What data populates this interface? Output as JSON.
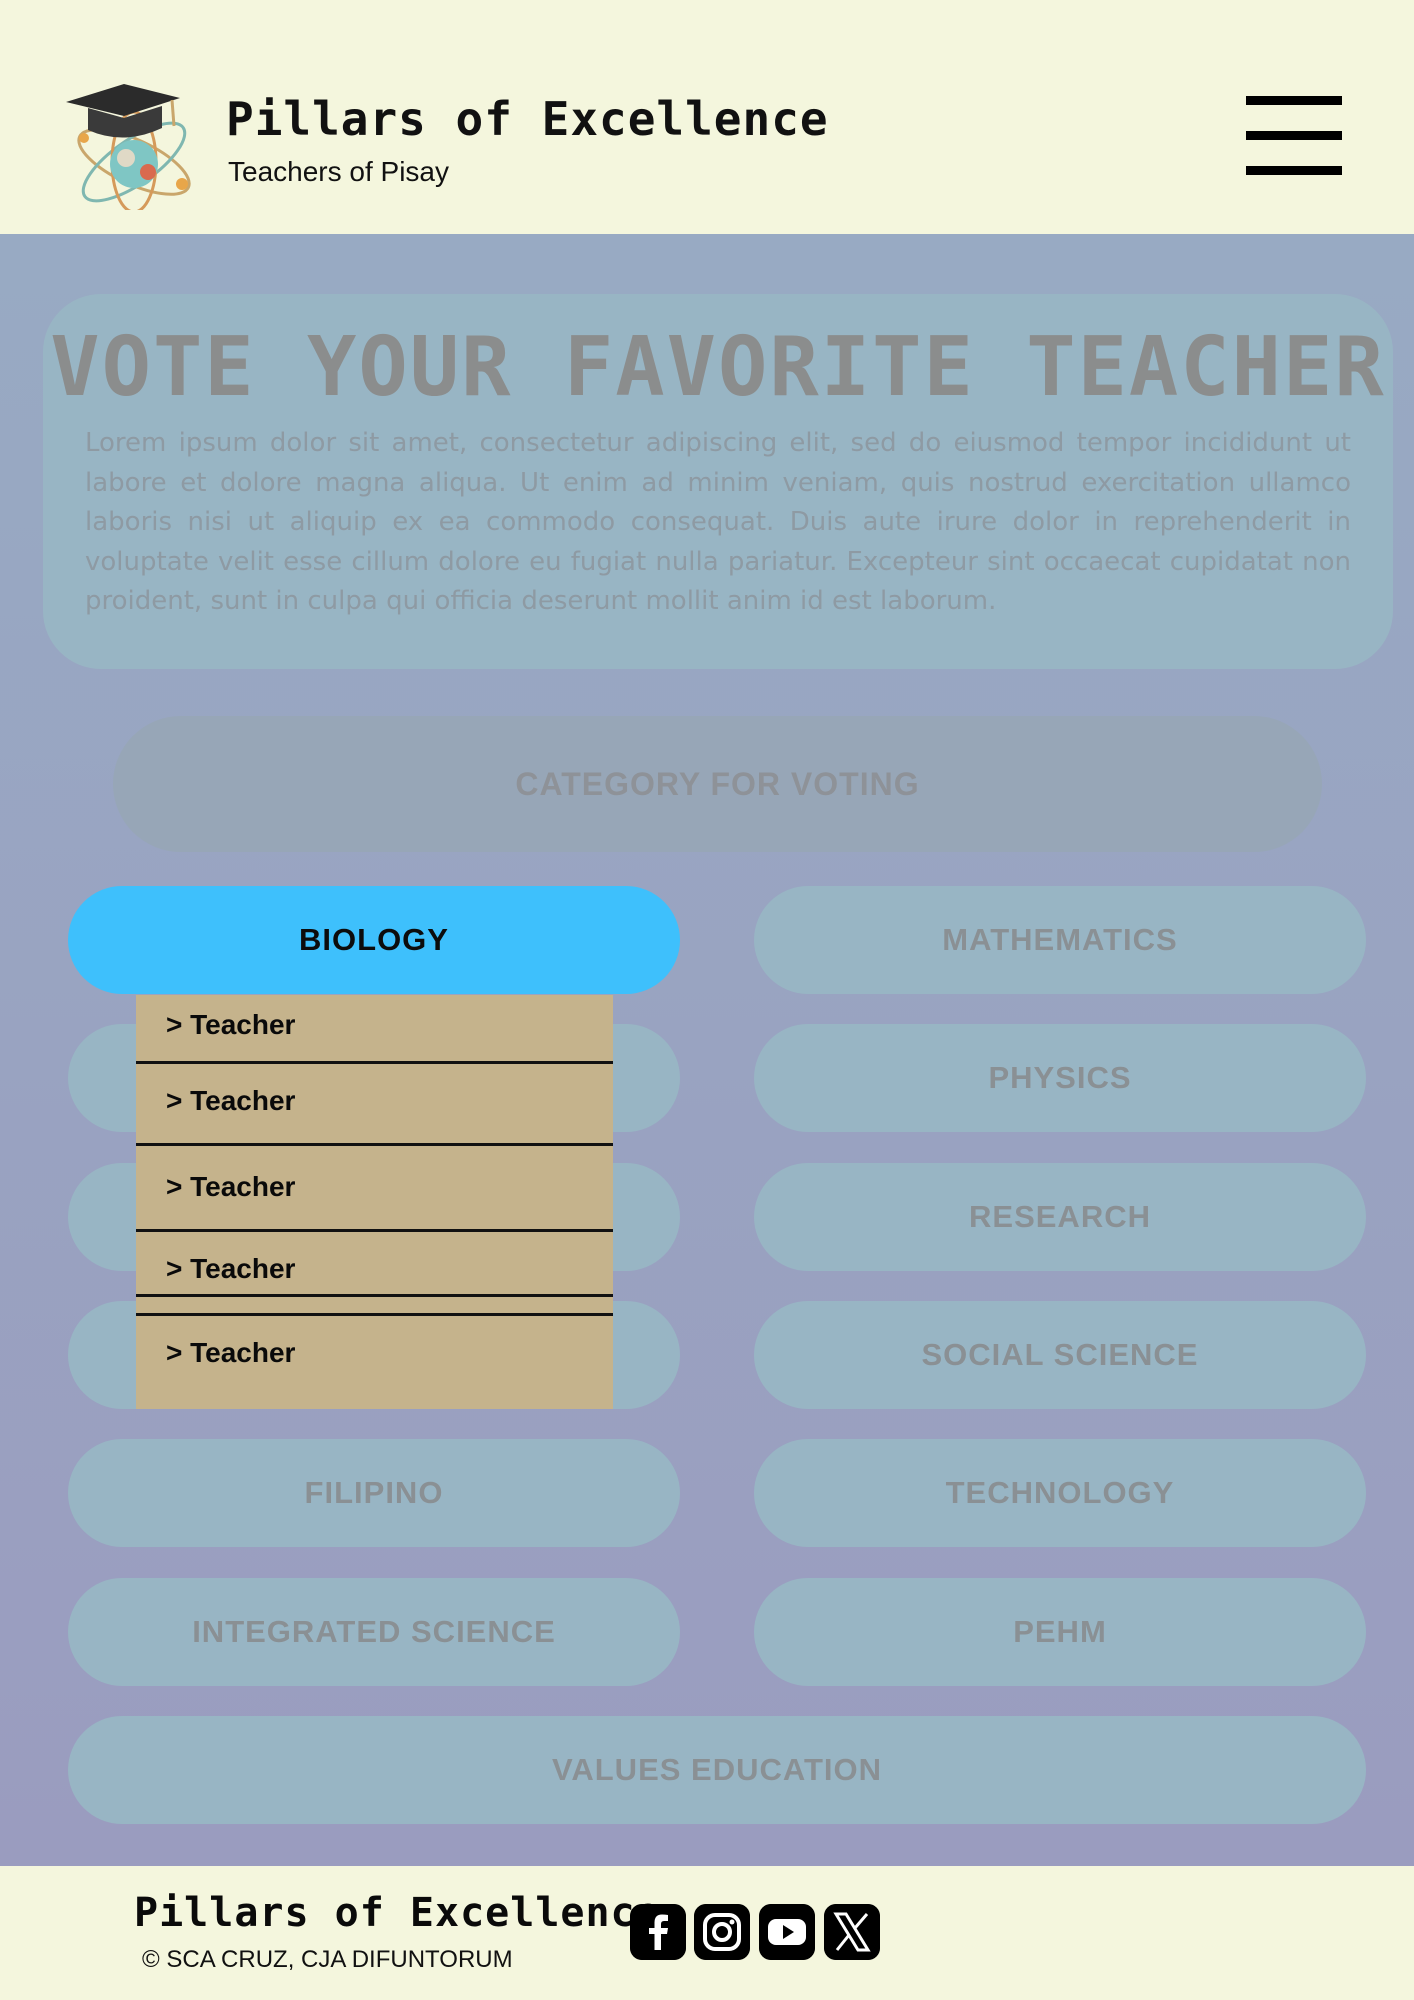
{
  "header": {
    "brand_title": "Pillars of Excellence",
    "brand_subtitle": "Teachers of Pisay",
    "logo_icon": "graduation-cap-atom-logo",
    "menu_icon": "hamburger-menu-icon"
  },
  "intro": {
    "title": "VOTE YOUR FAVORITE TEACHER",
    "body": "Lorem ipsum dolor sit amet, consectetur adipiscing elit, sed do eiusmod tempor incididunt ut labore et dolore magna aliqua. Ut enim ad minim veniam, quis nostrud exercitation ullamco laboris nisi ut aliquip ex ea commodo consequat. Duis aute irure dolor in reprehenderit in voluptate velit esse cillum dolore eu fugiat nulla pariatur. Excepteur sint occaecat cupidatat non proident, sunt in culpa qui officia deserunt mollit anim id est laborum."
  },
  "categories": {
    "header": "CATEGORY FOR VOTING",
    "items": [
      {
        "label": "BIOLOGY",
        "active": true
      },
      {
        "label": "MATHEMATICS"
      },
      {
        "label": ""
      },
      {
        "label": "PHYSICS"
      },
      {
        "label": ""
      },
      {
        "label": "RESEARCH"
      },
      {
        "label": ""
      },
      {
        "label": "SOCIAL SCIENCE"
      },
      {
        "label": "FILIPINO"
      },
      {
        "label": "TECHNOLOGY"
      },
      {
        "label": "INTEGRATED SCIENCE"
      },
      {
        "label": "PEHM"
      },
      {
        "label": "VALUES EDUCATION"
      }
    ]
  },
  "dropdown": {
    "items": [
      "> Teacher",
      "> Teacher",
      "> Teacher",
      "> Teacher",
      "> Teacher"
    ]
  },
  "footer": {
    "brand_title": "Pillars of Excellence",
    "copyright": "© SCA CRUZ, CJA DIFUNTORUM",
    "social_icons": [
      "facebook-icon",
      "instagram-icon",
      "youtube-icon",
      "x-icon"
    ]
  },
  "colors": {
    "background": "#f4f6dd",
    "active_category": "#3ec0fc",
    "dropdown": "#c5b38c",
    "pill": "#98b5c4"
  }
}
